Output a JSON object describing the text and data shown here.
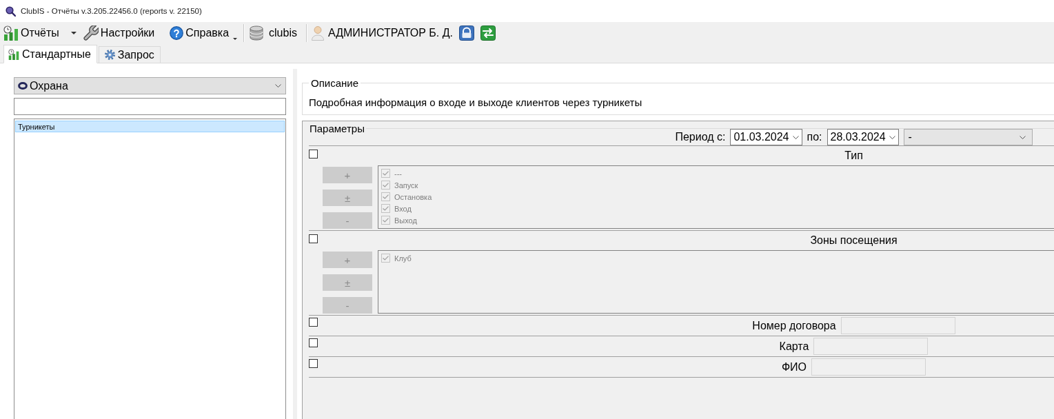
{
  "window": {
    "title": "ClubIS - Отчёты v.3.205.22456.0 (reports v. 22150)"
  },
  "toolbar": {
    "items": [
      {
        "kind": "reports",
        "label": "Отчёты",
        "dropdown": true
      },
      {
        "kind": "settings",
        "label": "Настройки",
        "dropdown": false
      },
      {
        "kind": "help",
        "label": "Справка",
        "dropdown": true
      },
      {
        "kind": "database",
        "label": "clubis",
        "dropdown": false
      },
      {
        "kind": "user",
        "label": "АДМИНИСТРАТОР Б. Д.",
        "dropdown": false
      }
    ]
  },
  "tabs": [
    {
      "kind": "standard",
      "label": "Стандартные",
      "selected": true
    },
    {
      "kind": "query",
      "label": "Запрос",
      "selected": false
    }
  ],
  "sidebar": {
    "category": "Охрана",
    "reports": [
      {
        "label": "Турникеты",
        "selected": true
      }
    ]
  },
  "description": {
    "title": "Описание",
    "text": "Подробная информация о входе и выходе клиентов через турникеты"
  },
  "parameters": {
    "title": "Параметры",
    "period": {
      "from_label": "Период с:",
      "from": "01.03.2024",
      "to_label": "по:",
      "to": "28.03.2024",
      "preset": "-"
    },
    "sections": [
      {
        "kind": "list",
        "title": "Тип",
        "checked": false,
        "buttons": [
          "+",
          "±",
          "-"
        ],
        "items": [
          {
            "label": "---",
            "checked": true
          },
          {
            "label": "Запуск",
            "checked": true
          },
          {
            "label": "Остановка",
            "checked": true
          },
          {
            "label": "Вход",
            "checked": true
          },
          {
            "label": "Выход",
            "checked": true
          }
        ]
      },
      {
        "kind": "list",
        "title": "Зоны посещения",
        "checked": false,
        "buttons": [
          "+",
          "±",
          "-"
        ],
        "items": [
          {
            "label": "Клуб",
            "checked": true
          }
        ]
      },
      {
        "kind": "field",
        "label": "Номер договора",
        "checked": false
      },
      {
        "kind": "field",
        "label": "Карта",
        "checked": false
      },
      {
        "kind": "field",
        "label": "ФИО",
        "checked": false
      }
    ]
  }
}
